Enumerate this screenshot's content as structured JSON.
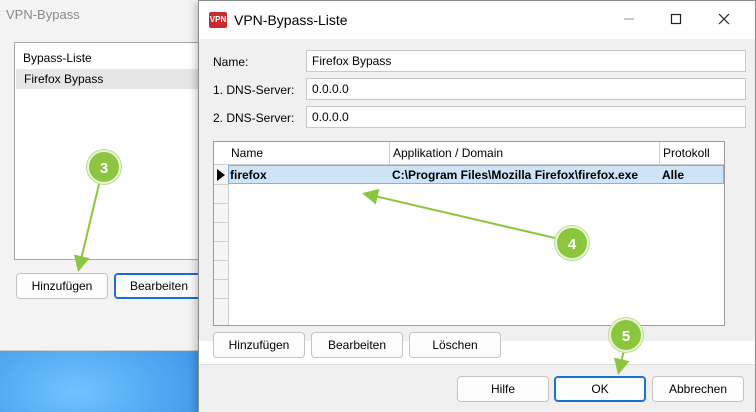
{
  "back_window": {
    "title": "VPN-Bypass",
    "list_header": "Bypass-Liste",
    "list_items": [
      "Firefox Bypass"
    ],
    "buttons": {
      "add": "Hinzufügen",
      "edit": "Bearbeiten"
    }
  },
  "dialog": {
    "title": "VPN-Bypass-Liste",
    "icon_text": "VPN",
    "fields": {
      "name_label": "Name:",
      "name_value": "Firefox Bypass",
      "dns1_label": "1. DNS-Server:",
      "dns1_value": "0.0.0.0",
      "dns2_label": "2. DNS-Server:",
      "dns2_value": "0.0.0.0"
    },
    "grid": {
      "columns": [
        "Name",
        "Applikation / Domain",
        "Protokoll"
      ],
      "rows": [
        {
          "name": "firefox",
          "application": "C:\\Program Files\\Mozilla Firefox\\firefox.exe",
          "protocol": "Alle"
        }
      ]
    },
    "grid_buttons": {
      "add": "Hinzufügen",
      "edit": "Bearbeiten",
      "delete": "Löschen"
    },
    "footer_buttons": {
      "help": "Hilfe",
      "ok": "OK",
      "cancel": "Abbrechen"
    }
  },
  "annotations": {
    "step3": "3",
    "step4": "4",
    "step5": "5"
  },
  "colors": {
    "badge": "#8cc63e",
    "selection": "#cde3f7",
    "accent": "#1a6fd2"
  }
}
